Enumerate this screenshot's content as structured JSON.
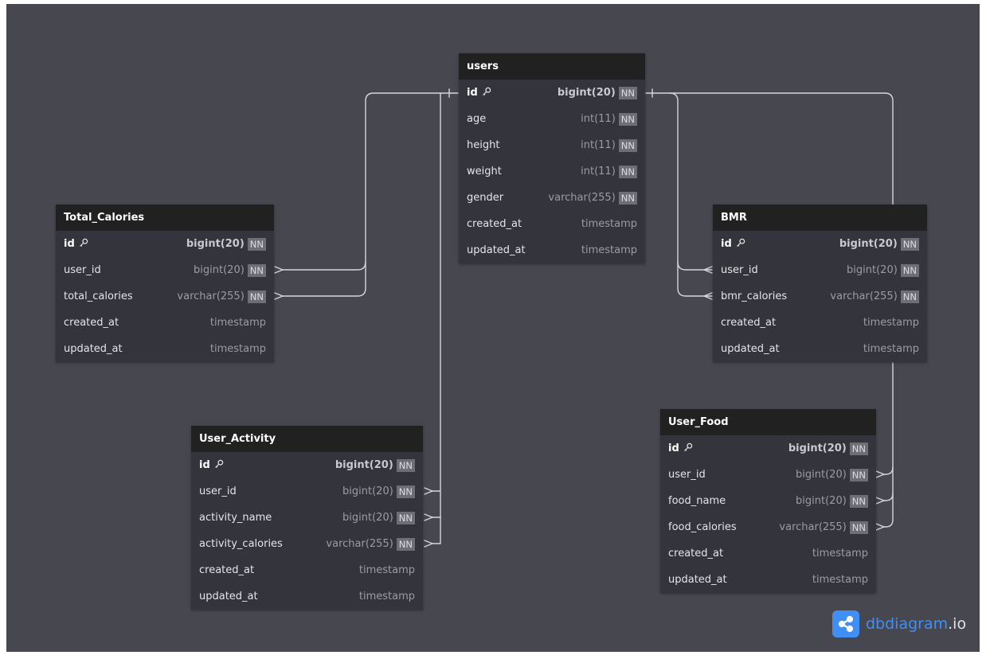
{
  "tables": [
    {
      "id": "users",
      "name": "users",
      "fields": [
        {
          "name": "id",
          "type": "bigint(20)",
          "nn": "NN",
          "pk": true
        },
        {
          "name": "age",
          "type": "int(11)",
          "nn": "NN"
        },
        {
          "name": "height",
          "type": "int(11)",
          "nn": "NN"
        },
        {
          "name": "weight",
          "type": "int(11)",
          "nn": "NN"
        },
        {
          "name": "gender",
          "type": "varchar(255)",
          "nn": "NN"
        },
        {
          "name": "created_at",
          "type": "timestamp"
        },
        {
          "name": "updated_at",
          "type": "timestamp"
        }
      ]
    },
    {
      "id": "total-calories",
      "name": "Total_Calories",
      "fields": [
        {
          "name": "id",
          "type": "bigint(20)",
          "nn": "NN",
          "pk": true
        },
        {
          "name": "user_id",
          "type": "bigint(20)",
          "nn": "NN"
        },
        {
          "name": "total_calories",
          "type": "varchar(255)",
          "nn": "NN"
        },
        {
          "name": "created_at",
          "type": "timestamp"
        },
        {
          "name": "updated_at",
          "type": "timestamp"
        }
      ]
    },
    {
      "id": "bmr",
      "name": "BMR",
      "fields": [
        {
          "name": "id",
          "type": "bigint(20)",
          "nn": "NN",
          "pk": true
        },
        {
          "name": "user_id",
          "type": "bigint(20)",
          "nn": "NN"
        },
        {
          "name": "bmr_calories",
          "type": "varchar(255)",
          "nn": "NN"
        },
        {
          "name": "created_at",
          "type": "timestamp"
        },
        {
          "name": "updated_at",
          "type": "timestamp"
        }
      ]
    },
    {
      "id": "user-activity",
      "name": "User_Activity",
      "fields": [
        {
          "name": "id",
          "type": "bigint(20)",
          "nn": "NN",
          "pk": true
        },
        {
          "name": "user_id",
          "type": "bigint(20)",
          "nn": "NN"
        },
        {
          "name": "activity_name",
          "type": "bigint(20)",
          "nn": "NN"
        },
        {
          "name": "activity_calories",
          "type": "varchar(255)",
          "nn": "NN"
        },
        {
          "name": "created_at",
          "type": "timestamp"
        },
        {
          "name": "updated_at",
          "type": "timestamp"
        }
      ]
    },
    {
      "id": "user-food",
      "name": "User_Food",
      "fields": [
        {
          "name": "id",
          "type": "bigint(20)",
          "nn": "NN",
          "pk": true
        },
        {
          "name": "user_id",
          "type": "bigint(20)",
          "nn": "NN"
        },
        {
          "name": "food_name",
          "type": "bigint(20)",
          "nn": "NN"
        },
        {
          "name": "food_calories",
          "type": "varchar(255)",
          "nn": "NN"
        },
        {
          "name": "created_at",
          "type": "timestamp"
        },
        {
          "name": "updated_at",
          "type": "timestamp"
        }
      ]
    }
  ],
  "relationships": [
    {
      "from": "total-calories.user_id",
      "to": "users.id"
    },
    {
      "from": "total-calories.total_calories",
      "to": "users.id"
    },
    {
      "from": "user-activity.user_id",
      "to": "users.id"
    },
    {
      "from": "user-activity.activity_name",
      "to": "users.id"
    },
    {
      "from": "user-activity.activity_calories",
      "to": "users.id"
    },
    {
      "from": "bmr.user_id",
      "to": "users.id"
    },
    {
      "from": "bmr.bmr_calories",
      "to": "users.id"
    },
    {
      "from": "user-food.user_id",
      "to": "users.id"
    },
    {
      "from": "user-food.food_name",
      "to": "users.id"
    },
    {
      "from": "user-food.food_calories",
      "to": "users.id"
    }
  ],
  "logo": {
    "brand": "dbdiagram",
    "suffix": ".io",
    "icon": "share-icon"
  },
  "colors": {
    "canvas": "#46474f",
    "table_body": "#34353c",
    "table_header": "#212121",
    "brand": "#3f8ff4"
  }
}
